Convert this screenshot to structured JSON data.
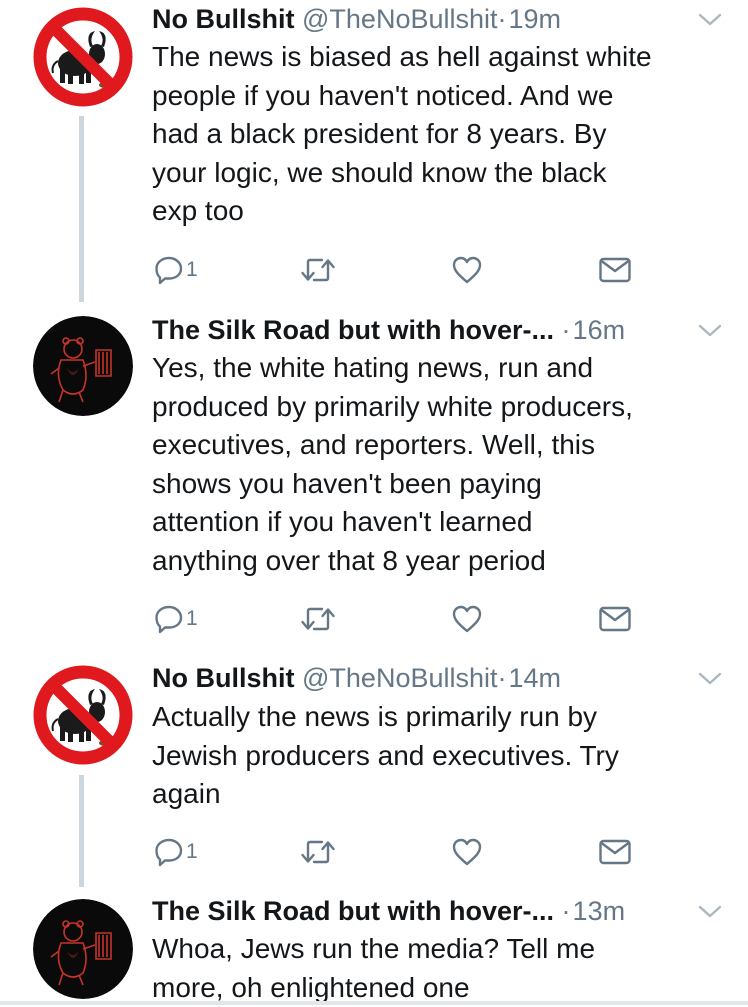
{
  "tweets": [
    {
      "name": "No Bullshit",
      "handle": "@TheNoBullshit",
      "separator": "·",
      "time": "19m",
      "lines": [
        "The news is biased as hell against white",
        "people if you haven't noticed. And we",
        "had a black president for 8 years. By",
        "your logic, we should know the black",
        "exp too"
      ],
      "reply_count": "1",
      "avatar_icon": "no-bull-sign-icon"
    },
    {
      "name": "The Silk Road but with hover-...",
      "handle": "",
      "separator": "·",
      "time": "16m",
      "lines": [
        "Yes, the white hating news, run and",
        "produced by primarily white producers,",
        "executives, and reporters. Well, this",
        "shows you haven't been paying",
        "attention if you haven't learned",
        "anything over that 8 year period"
      ],
      "reply_count": "1",
      "avatar_icon": "red-bear-avatar"
    },
    {
      "name": "No Bullshit",
      "handle": "@TheNoBullshit",
      "separator": "·",
      "time": "14m",
      "lines": [
        "Actually the news is primarily run by",
        "Jewish producers and executives. Try",
        "again"
      ],
      "reply_count": "1",
      "avatar_icon": "no-bull-sign-icon"
    },
    {
      "name": "The Silk Road but with hover-...",
      "handle": "",
      "separator": "·",
      "time": "13m",
      "lines": [
        "Whoa, Jews run the media? Tell me",
        "more, oh enlightened one"
      ],
      "reply_count": "",
      "avatar_icon": "red-bear-avatar"
    }
  ],
  "colors": {
    "text": "#14171a",
    "secondary": "#657786",
    "thread_line": "#ccd6dd",
    "sign_red": "#e0191f"
  }
}
